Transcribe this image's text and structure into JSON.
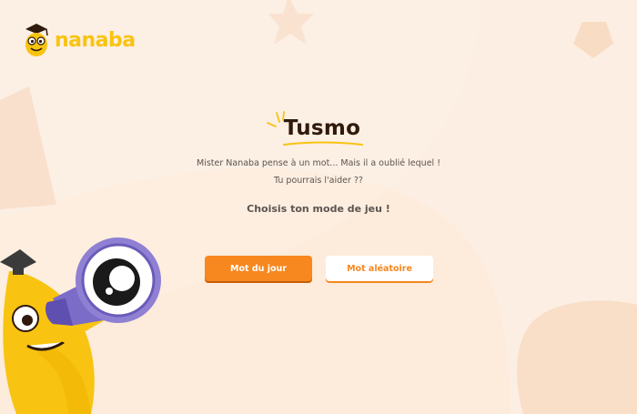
{
  "header": {
    "logo_text": "nanaba"
  },
  "game": {
    "title": "Tusmo",
    "intro_line1": "Mister Nanaba pense à un mot... Mais il a oublié lequel !",
    "intro_line2": "Tu pourrais l'aider ??",
    "mode_prompt": "Choisis ton mode de jeu !"
  },
  "buttons": {
    "daily_label": "Mot du jour",
    "random_label": "Mot aléatoire"
  },
  "colors": {
    "accent": "#f7871f",
    "brand_yellow": "#f8c411",
    "background": "#fdeee0",
    "title": "#2f1a0c"
  }
}
